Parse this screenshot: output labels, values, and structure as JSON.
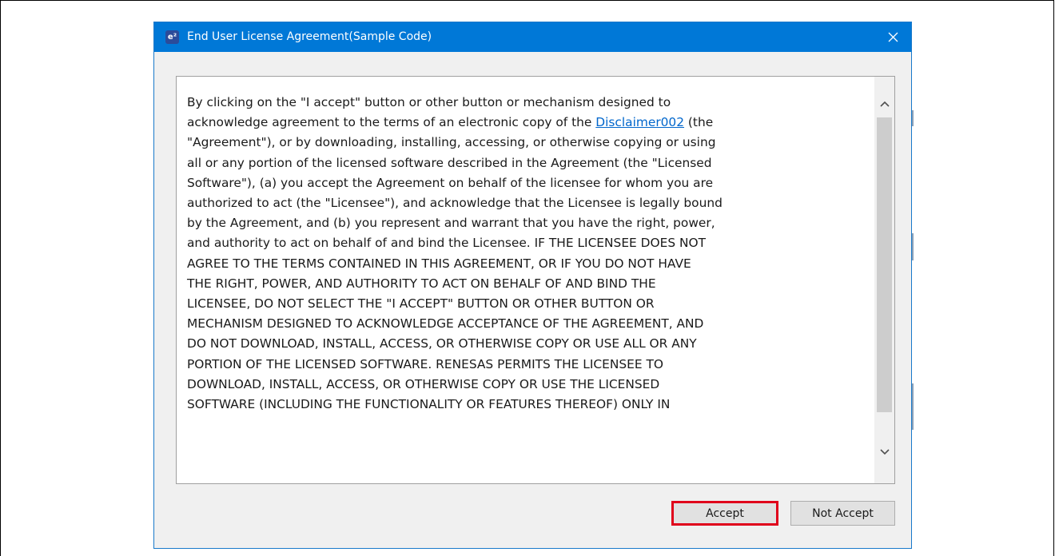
{
  "dialog": {
    "icon_text": "e²",
    "title": "End User License Agreement(Sample Code)",
    "close_glyph": "✕"
  },
  "license": {
    "line1": "By clicking on the \"I accept\" button or other button or mechanism designed to",
    "line2_before": "acknowledge agreement to the terms of an electronic copy of the ",
    "line2_link": "Disclaimer002",
    "line2_after": " (the",
    "lines": [
      "\"Agreement\"), or by downloading, installing, accessing, or otherwise copying or using",
      "all or any portion of the licensed software described in the Agreement (the \"Licensed",
      "Software\"), (a) you accept the Agreement on behalf of the licensee for whom you are",
      "authorized to act (the \"Licensee\"), and acknowledge that the Licensee is legally bound",
      "by the Agreement, and (b) you represent and warrant that you have the right, power,",
      "and authority to act on behalf of and bind the Licensee. IF THE LICENSEE DOES NOT",
      "AGREE TO THE TERMS CONTAINED IN THIS AGREEMENT, OR IF YOU DO NOT HAVE",
      "THE RIGHT, POWER, AND AUTHORITY TO ACT ON BEHALF OF AND BIND THE",
      "LICENSEE, DO NOT SELECT THE \"I ACCEPT\" BUTTON OR OTHER BUTTON OR",
      "MECHANISM DESIGNED TO ACKNOWLEDGE ACCEPTANCE OF THE AGREEMENT, AND",
      "DO NOT DOWNLOAD, INSTALL, ACCESS, OR OTHERWISE COPY OR USE ALL OR ANY",
      "PORTION OF THE LICENSED SOFTWARE. RENESAS PERMITS THE LICENSEE TO",
      "DOWNLOAD, INSTALL, ACCESS, OR OTHERWISE COPY OR USE THE LICENSED",
      "SOFTWARE (INCLUDING THE FUNCTIONALITY OR FEATURES THEREOF) ONLY IN"
    ]
  },
  "buttons": {
    "accept": "Accept",
    "not_accept": "Not Accept"
  },
  "scrollbar": {
    "position_fraction": 0.0
  },
  "colors": {
    "titlebar": "#0078d7",
    "link": "#0066cc",
    "highlight": "#e0001b",
    "dialog_bg": "#f0f0f0"
  },
  "icons": {
    "app": "e2-studio-icon",
    "close": "close-icon",
    "scroll_up": "chevron-up-icon",
    "scroll_down": "chevron-down-icon"
  }
}
